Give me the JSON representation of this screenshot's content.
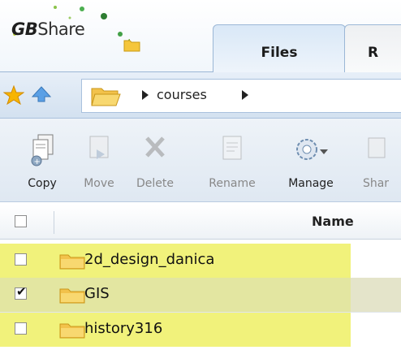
{
  "app": {
    "logo_bold": "GB",
    "logo_rest": "Share"
  },
  "tabs": [
    {
      "label": "Files"
    },
    {
      "label": "R"
    }
  ],
  "breadcrumb": {
    "path": "courses"
  },
  "toolbar": {
    "copy": "Copy",
    "move": "Move",
    "delete": "Delete",
    "rename": "Rename",
    "manage": "Manage",
    "share": "Shar"
  },
  "table": {
    "column_name": "Name",
    "rows": [
      {
        "name": "2d_design_danica",
        "checked": false
      },
      {
        "name": "GIS",
        "checked": true
      },
      {
        "name": "history316",
        "checked": false
      }
    ]
  },
  "colors": {
    "highlight": "#ffff7f",
    "accent": "#9bb7d6"
  }
}
